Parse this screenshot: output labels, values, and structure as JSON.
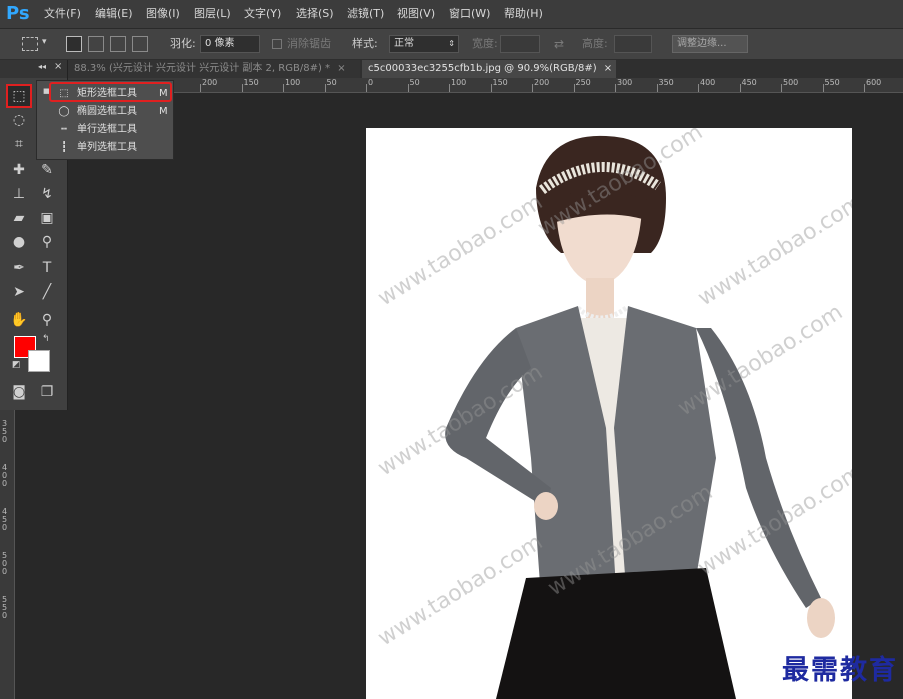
{
  "app": {
    "logo": "Ps"
  },
  "menu": [
    {
      "label": "文件(F)"
    },
    {
      "label": "编辑(E)"
    },
    {
      "label": "图像(I)"
    },
    {
      "label": "图层(L)"
    },
    {
      "label": "文字(Y)"
    },
    {
      "label": "选择(S)"
    },
    {
      "label": "滤镜(T)"
    },
    {
      "label": "视图(V)"
    },
    {
      "label": "窗口(W)"
    },
    {
      "label": "帮助(H)"
    }
  ],
  "options": {
    "feather_label": "羽化:",
    "feather_value": "0 像素",
    "antialias_label": "消除锯齿",
    "style_label": "样式:",
    "style_value": "正常",
    "width_label": "宽度:",
    "height_label": "高度:",
    "refine_edge": "调整边缘..."
  },
  "tabs": [
    {
      "label": "88.3% (兴元设计 兴元设计 兴元设计 副本 2, RGB/8#) *",
      "close": "×"
    },
    {
      "label": "c5c00033ec3255cfb1b.jpg @ 90.9%(RGB/8#)",
      "close": "×"
    }
  ],
  "toolbar_header": {
    "collapse": "◂◂",
    "close": "×"
  },
  "ruler": {
    "h": [
      "200",
      "150",
      "100",
      "50",
      "0",
      "50",
      "100",
      "150",
      "200",
      "250",
      "300",
      "350",
      "400",
      "450",
      "500",
      "550",
      "600"
    ],
    "v": [
      "350",
      "400",
      "450",
      "500",
      "550"
    ]
  },
  "flyout": [
    {
      "icon": "rect-marquee-icon",
      "glyph": "⬚",
      "label": "矩形选框工具",
      "key": "M"
    },
    {
      "icon": "ellipse-marquee-icon",
      "glyph": "◯",
      "label": "椭圆选框工具",
      "key": "M"
    },
    {
      "icon": "single-row-marquee-icon",
      "glyph": "┅",
      "label": "单行选框工具",
      "key": ""
    },
    {
      "icon": "single-column-marquee-icon",
      "glyph": "┇",
      "label": "单列选框工具",
      "key": ""
    }
  ],
  "watermark": "www.taobao.com",
  "corner_logo": "最需教育",
  "colors": {
    "foreground": "#ff0000",
    "background": "#ffffff",
    "highlight": "#e02020"
  }
}
